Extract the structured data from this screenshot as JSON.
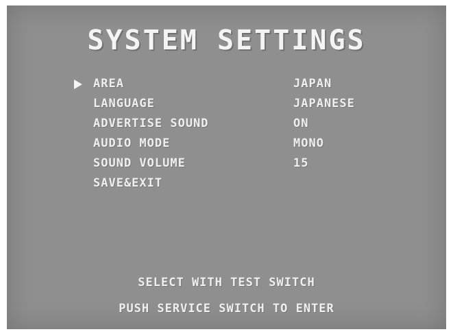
{
  "title": "SYSTEM SETTINGS",
  "menu": {
    "cursor_icon": "triangle-right",
    "items": [
      {
        "label": "AREA",
        "value": "JAPAN"
      },
      {
        "label": "LANGUAGE",
        "value": "JAPANESE"
      },
      {
        "label": "ADVERTISE SOUND",
        "value": "ON"
      },
      {
        "label": "AUDIO MODE",
        "value": "MONO"
      },
      {
        "label": "SOUND VOLUME",
        "value": "15"
      },
      {
        "label": "SAVE&EXIT",
        "value": ""
      }
    ]
  },
  "footer": {
    "line1": "SELECT WITH TEST SWITCH",
    "line2": "PUSH SERVICE SWITCH TO ENTER"
  },
  "colors": {
    "background": "#8f8f8f",
    "text": "#efefef"
  }
}
